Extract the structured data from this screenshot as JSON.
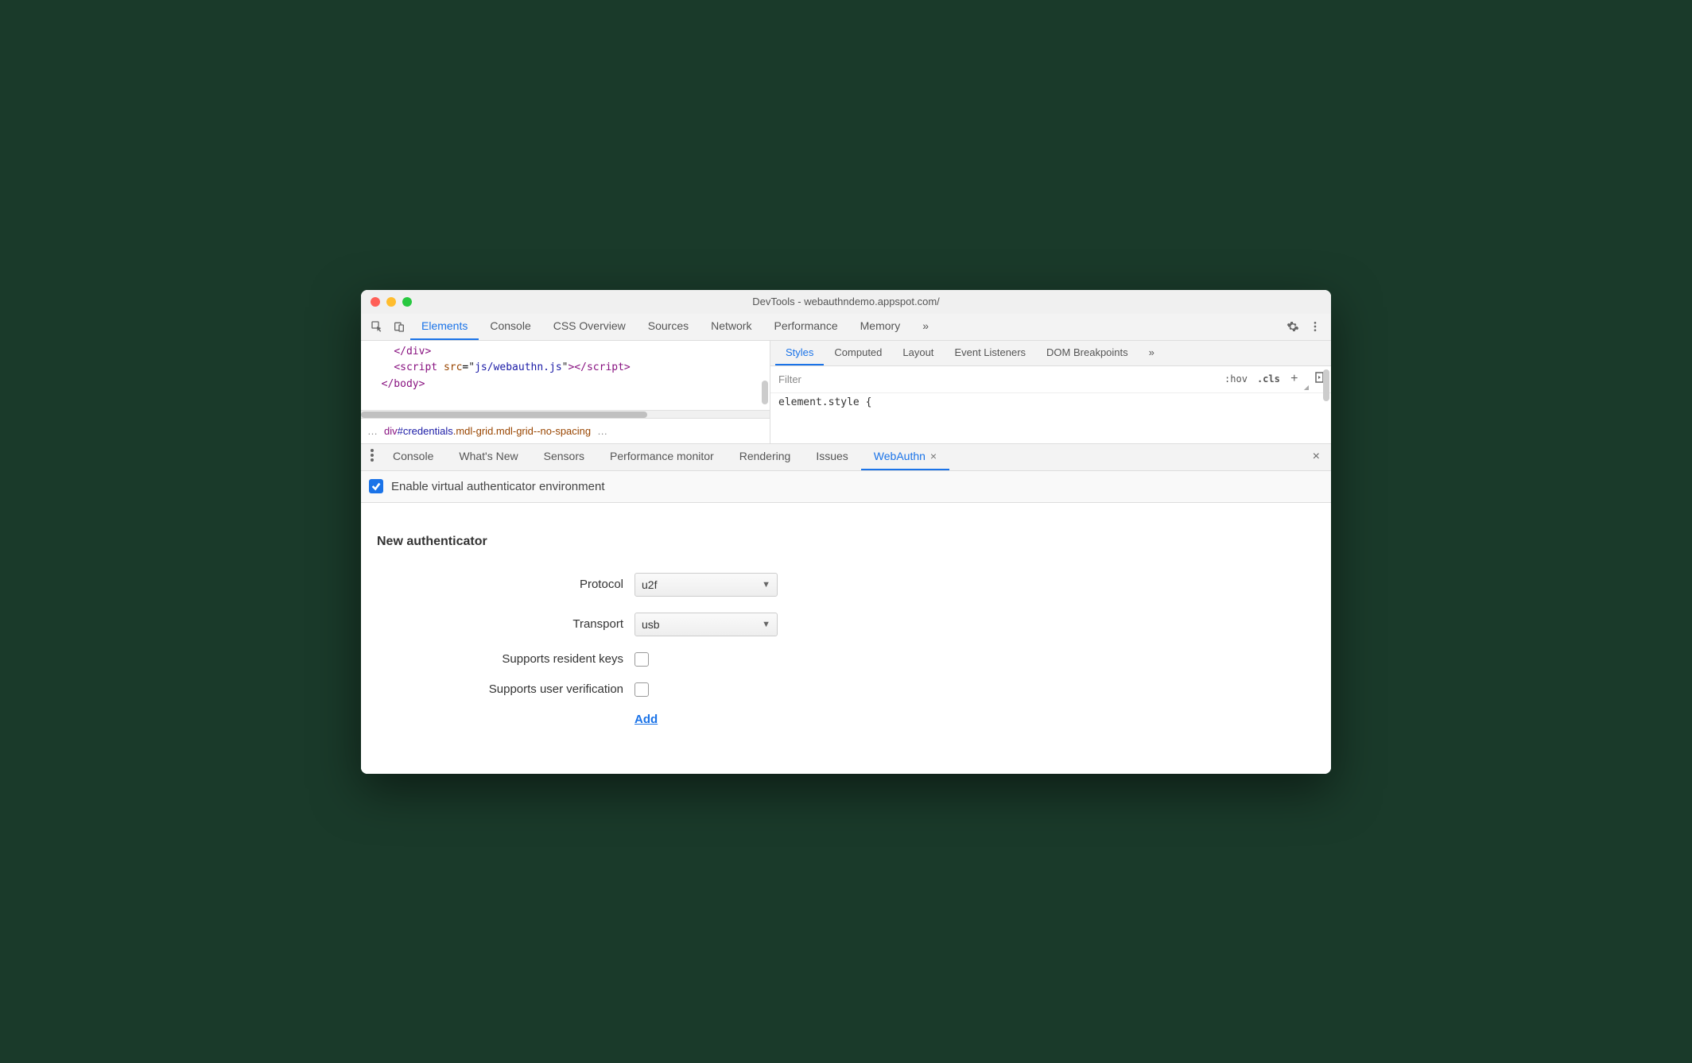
{
  "window": {
    "title": "DevTools - webauthndemo.appspot.com/"
  },
  "main_tabs": [
    "Elements",
    "Console",
    "CSS Overview",
    "Sources",
    "Network",
    "Performance",
    "Memory"
  ],
  "main_active": "Elements",
  "more_glyph": "»",
  "code": {
    "lines": [
      {
        "indent": "    ",
        "parts": [
          {
            "t": "tag",
            "v": "</div>"
          }
        ]
      },
      {
        "indent": "    ",
        "parts": [
          {
            "t": "tag",
            "v": "<script "
          },
          {
            "t": "attr",
            "v": "src"
          },
          {
            "t": "plain",
            "v": "="
          },
          {
            "t": "quote",
            "v": "\""
          },
          {
            "t": "str",
            "v": "js/webauthn.js"
          },
          {
            "t": "quote",
            "v": "\""
          },
          {
            "t": "tag",
            "v": "></script>"
          }
        ]
      },
      {
        "indent": "  ",
        "parts": [
          {
            "t": "tag",
            "v": "</body>"
          }
        ]
      }
    ]
  },
  "breadcrumb": {
    "left_ell": "…",
    "tag": "div",
    "id": "#credentials",
    "classes": ".mdl-grid.mdl-grid--no-spacing",
    "right_ell": "…"
  },
  "sub_tabs": [
    "Styles",
    "Computed",
    "Layout",
    "Event Listeners",
    "DOM Breakpoints"
  ],
  "sub_active": "Styles",
  "filter": {
    "placeholder": "Filter",
    "hov": ":hov",
    "cls": ".cls",
    "plus": "+"
  },
  "styles_body": "element.style {",
  "drawer_tabs": [
    "Console",
    "What's New",
    "Sensors",
    "Performance monitor",
    "Rendering",
    "Issues",
    "WebAuthn"
  ],
  "drawer_active": "WebAuthn",
  "enable": {
    "label": "Enable virtual authenticator environment",
    "checked": true
  },
  "form": {
    "title": "New authenticator",
    "rows": {
      "protocol": {
        "label": "Protocol",
        "value": "u2f"
      },
      "transport": {
        "label": "Transport",
        "value": "usb"
      },
      "resident": {
        "label": "Supports resident keys",
        "checked": false
      },
      "userverify": {
        "label": "Supports user verification",
        "checked": false
      }
    },
    "add": "Add"
  }
}
